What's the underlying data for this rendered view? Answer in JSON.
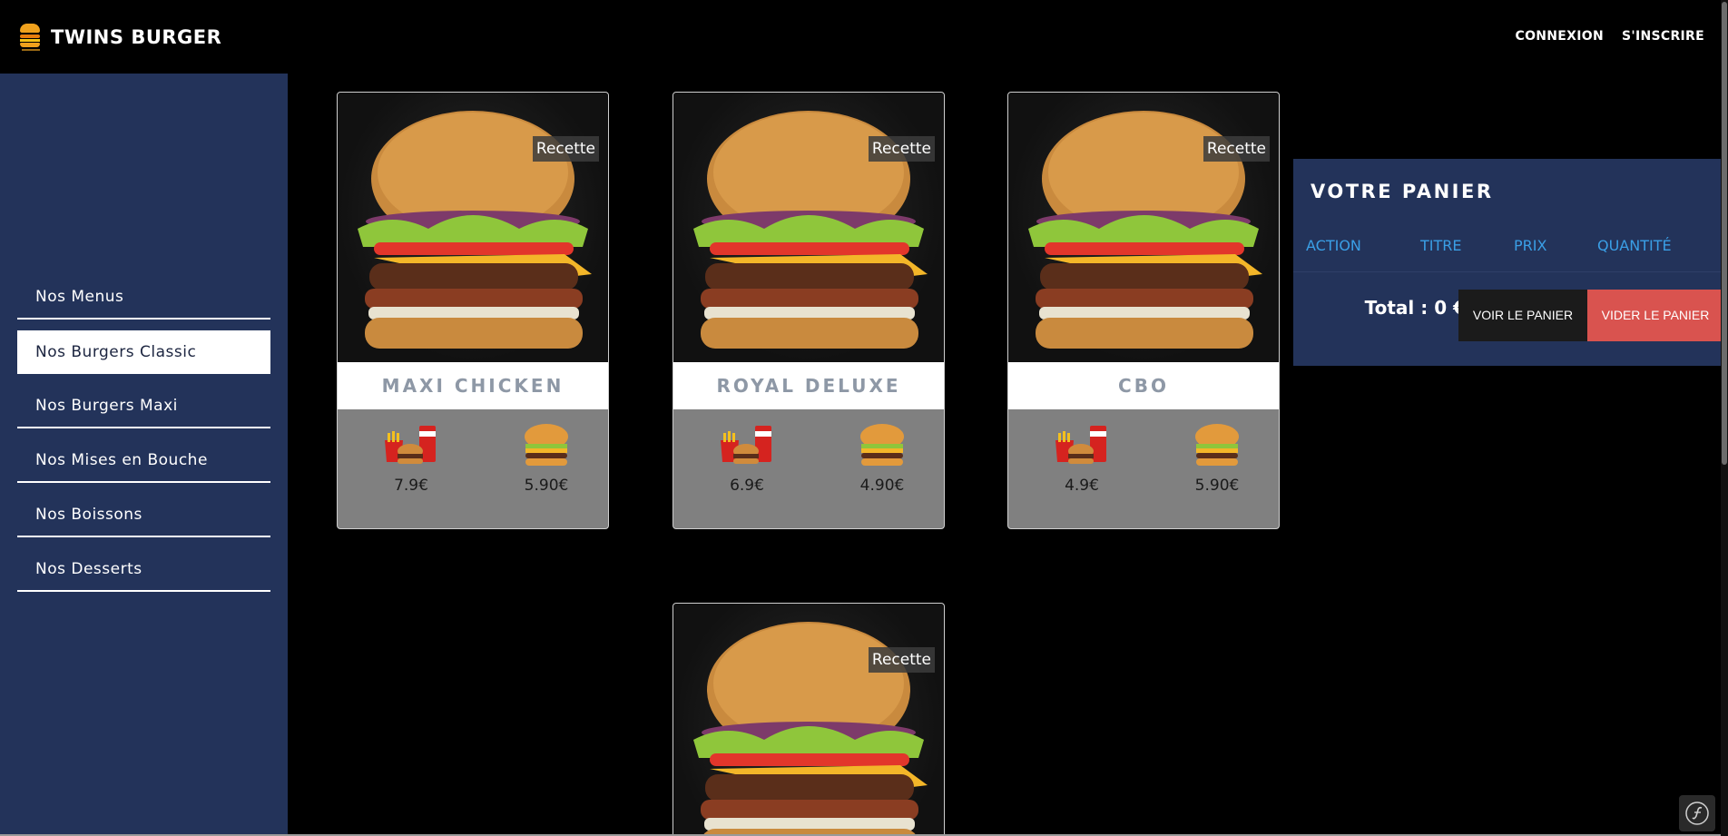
{
  "header": {
    "brand_name": "TWINS BURGER",
    "login_label": "CONNEXION",
    "signup_label": "S'INSCRIRE"
  },
  "sidebar": {
    "items": [
      {
        "label": "Nos Menus",
        "active": false
      },
      {
        "label": "Nos Burgers Classic",
        "active": true
      },
      {
        "label": "Nos Burgers Maxi",
        "active": false
      },
      {
        "label": "Nos Mises en Bouche",
        "active": false
      },
      {
        "label": "Nos Boissons",
        "active": false
      },
      {
        "label": "Nos Desserts",
        "active": false
      }
    ]
  },
  "products": [
    {
      "badge": "Recette",
      "title": "MAXI CHICKEN",
      "menu_price": "7.9€",
      "burger_price": "5.90€"
    },
    {
      "badge": "Recette",
      "title": "ROYAL DELUXE",
      "menu_price": "6.9€",
      "burger_price": "4.90€"
    },
    {
      "badge": "Recette",
      "title": "CBO",
      "menu_price": "4.9€",
      "burger_price": "5.90€"
    },
    {
      "badge": "Recette"
    }
  ],
  "cart": {
    "title": "VOTRE PANIER",
    "columns": [
      "ACTION",
      "TITRE",
      "PRIX",
      "QUANTITÉ"
    ],
    "total_label": "Total : 0 €",
    "view_button": "VOIR LE PANIER",
    "clear_button": "VIDER LE PANIER"
  },
  "colors": {
    "sidebar_bg": "#23335a",
    "accent_blue": "#3a9fe6",
    "clear_red": "#d9534f",
    "card_gray": "#808080"
  }
}
